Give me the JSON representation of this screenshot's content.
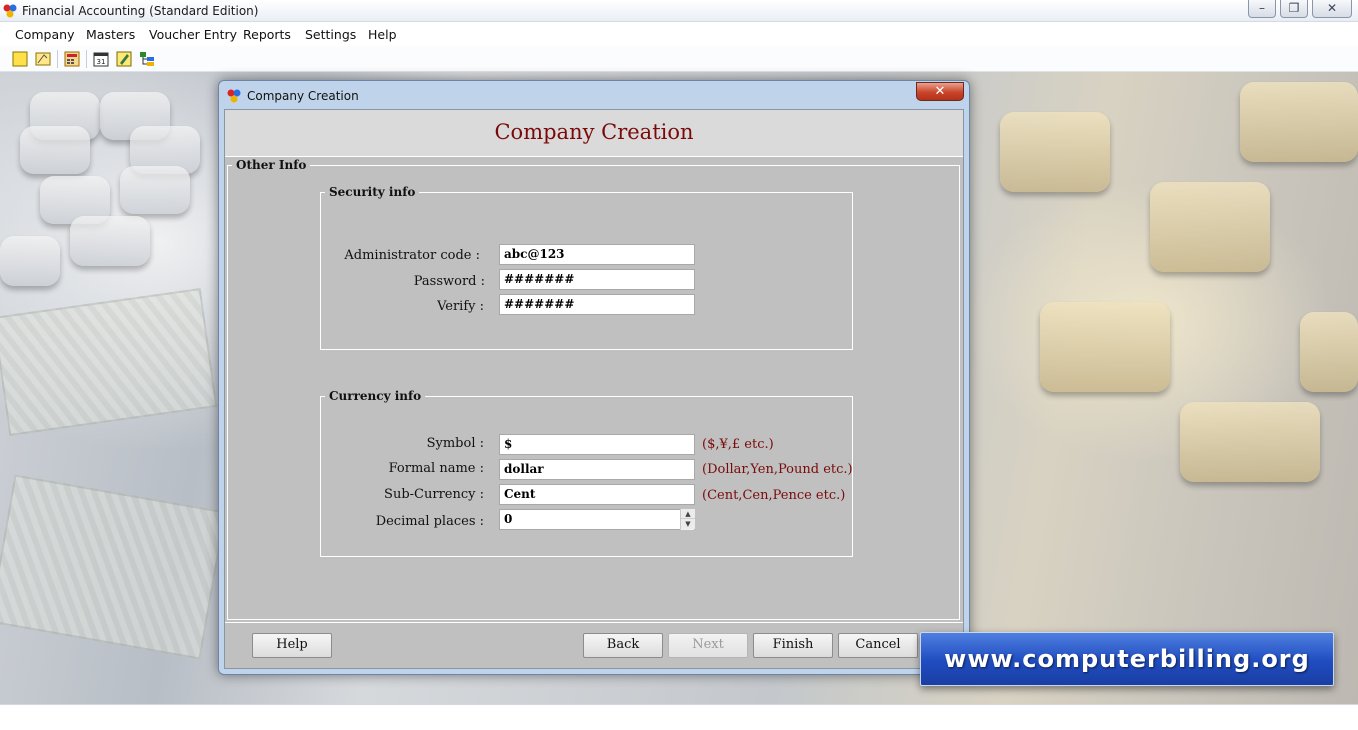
{
  "app": {
    "title": "Financial Accounting (Standard Edition)",
    "window_buttons": {
      "minimize": "–",
      "restore": "❐",
      "close": "✕"
    }
  },
  "menubar": {
    "items": [
      {
        "label": "Company"
      },
      {
        "label": "Masters"
      },
      {
        "label": "Voucher Entry"
      },
      {
        "label": "Reports"
      },
      {
        "label": "Settings"
      },
      {
        "label": "Help"
      }
    ]
  },
  "toolbar": {
    "icons": [
      "new-company-icon",
      "open-company-icon",
      "calculator-icon",
      "calendar-icon",
      "edit-icon",
      "tree-icon"
    ]
  },
  "dialog": {
    "title": "Company Creation",
    "close_glyph": "✕",
    "heading": "Company Creation",
    "outer_group_label": "Other Info",
    "security": {
      "legend": "Security info",
      "admin_code_label": "Administrator code :",
      "admin_code_value": "abc@123",
      "password_label": "Password :",
      "password_value": "#######",
      "verify_label": "Verify :",
      "verify_value": "#######"
    },
    "currency": {
      "legend": "Currency info",
      "symbol_label": "Symbol :",
      "symbol_value": "$",
      "symbol_hint": "($,¥,£ etc.)",
      "formal_name_label": "Formal name :",
      "formal_name_value": "dollar",
      "formal_name_hint": "(Dollar,Yen,Pound etc.)",
      "sub_currency_label": "Sub-Currency :",
      "sub_currency_value": "Cent",
      "sub_currency_hint": "(Cent,Cen,Pence etc.)",
      "decimal_label": "Decimal places :",
      "decimal_value": "0",
      "spin_up": "▲",
      "spin_down": "▼"
    },
    "buttons": {
      "help": "Help",
      "back": "Back",
      "next": "Next",
      "finish": "Finish",
      "cancel": "Cancel"
    }
  },
  "watermark": {
    "text": "www.computerbilling.org"
  },
  "colors": {
    "heading": "#7a0a0a",
    "dialog_frame": "#bfd4ea",
    "panel": "#c0c0c0",
    "banner": "#1f4cc0"
  }
}
